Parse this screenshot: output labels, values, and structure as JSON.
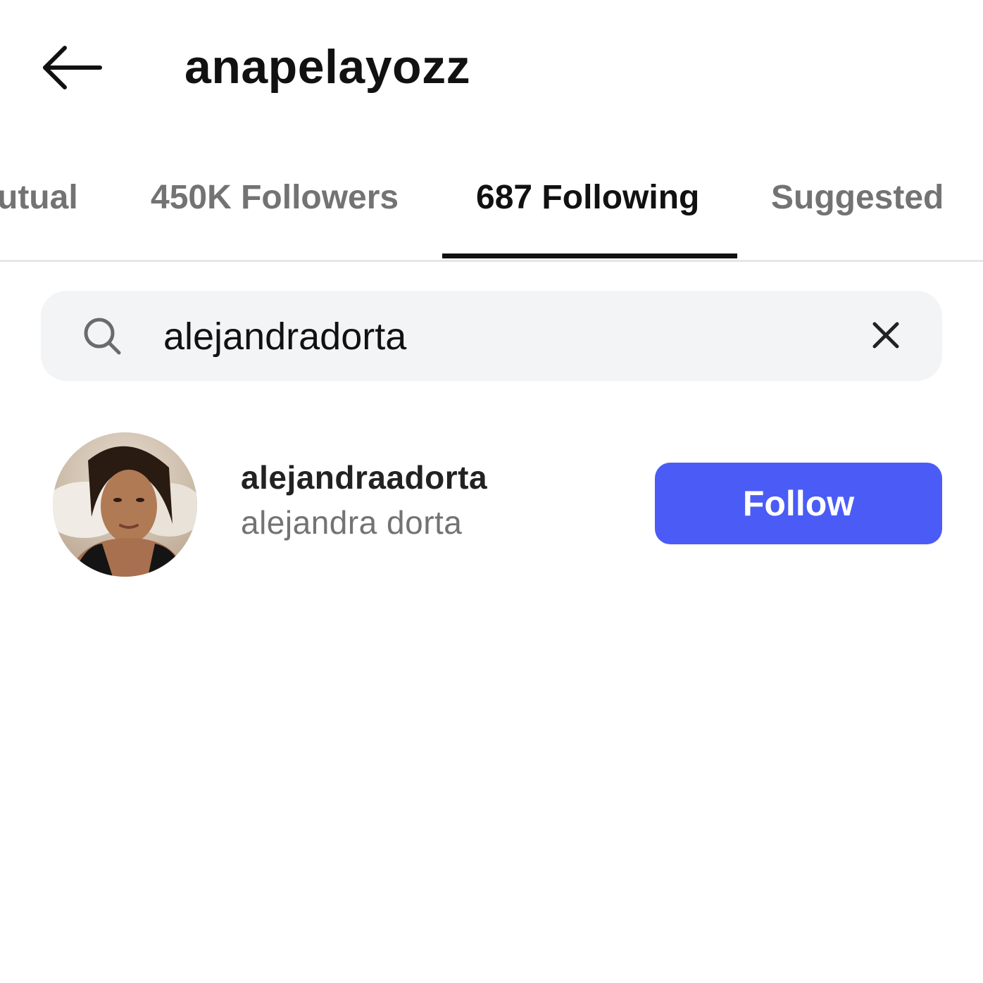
{
  "header": {
    "title": "anapelayozz",
    "back_icon": "arrow-left-icon"
  },
  "tabs": [
    {
      "label": "utual",
      "active": false
    },
    {
      "label": "450K Followers",
      "active": false
    },
    {
      "label": "687 Following",
      "active": true
    },
    {
      "label": "Suggested",
      "active": false
    }
  ],
  "search": {
    "value": "alejandradorta",
    "search_icon": "search-icon",
    "clear_icon": "close-icon"
  },
  "results": [
    {
      "username": "alejandraadorta",
      "full_name": "alejandra dorta",
      "action_label": "Follow"
    }
  ],
  "colors": {
    "accent": "#4a5cf5",
    "active_tab": "#111111",
    "inactive_tab": "#737373",
    "search_bg": "#f3f4f6"
  }
}
